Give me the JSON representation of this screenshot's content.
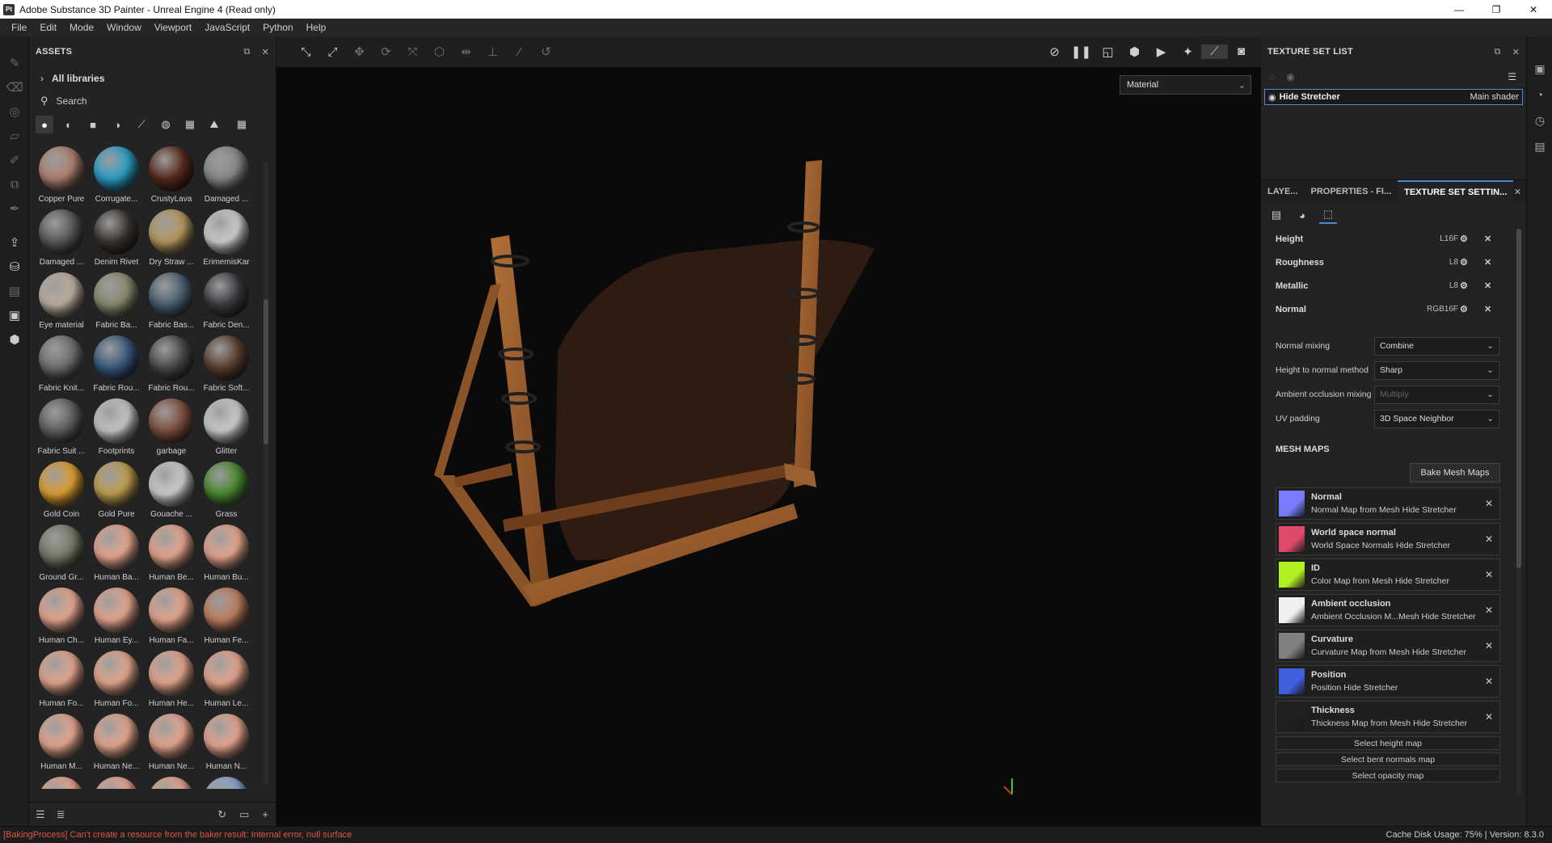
{
  "window": {
    "title": "Adobe Substance 3D Painter - Unreal Engine 4 (Read only)",
    "logo": "Pt"
  },
  "menu": [
    "File",
    "Edit",
    "Mode",
    "Window",
    "Viewport",
    "JavaScript",
    "Python",
    "Help"
  ],
  "assets": {
    "title": "ASSETS",
    "libraries": "All libraries",
    "search_placeholder": "Search",
    "items": [
      {
        "label": "Copper Pure",
        "color": "#b08070"
      },
      {
        "label": "Corrugate...",
        "color": "#2aa0c8"
      },
      {
        "label": "CrustyLava",
        "color": "#5a2a1c"
      },
      {
        "label": "Damaged ...",
        "color": "#8a8a8a"
      },
      {
        "label": "Damaged ...",
        "color": "#5a5a5a"
      },
      {
        "label": "Denim Rivet",
        "color": "#3a3430"
      },
      {
        "label": "Dry Straw ...",
        "color": "#b89a60"
      },
      {
        "label": "ErimemisKar",
        "color": "#d0d0d0"
      },
      {
        "label": "Eye material",
        "color": "#c0b0a0"
      },
      {
        "label": "Fabric Ba...",
        "color": "#8a8a70"
      },
      {
        "label": "Fabric Bas...",
        "color": "#4a6070"
      },
      {
        "label": "Fabric Den...",
        "color": "#3a3c40"
      },
      {
        "label": "Fabric Knit...",
        "color": "#707070"
      },
      {
        "label": "Fabric Rou...",
        "color": "#3a5a80"
      },
      {
        "label": "Fabric Rou...",
        "color": "#4a4a4a"
      },
      {
        "label": "Fabric Soft...",
        "color": "#5a4030"
      },
      {
        "label": "Fabric Suit ...",
        "color": "#606060"
      },
      {
        "label": "Footprints",
        "color": "#c8c8c8"
      },
      {
        "label": "garbage",
        "color": "#805040"
      },
      {
        "label": "Glitter",
        "color": "#d0d0d0"
      },
      {
        "label": "Gold Coin",
        "color": "#e0a030"
      },
      {
        "label": "Gold Pure",
        "color": "#c0a050"
      },
      {
        "label": "Gouache ...",
        "color": "#d0d0d0"
      },
      {
        "label": "Grass",
        "color": "#4a8a30"
      },
      {
        "label": "Ground Gr...",
        "color": "#7a7a6a"
      },
      {
        "label": "Human Ba...",
        "color": "#e8a890"
      },
      {
        "label": "Human Be...",
        "color": "#e8a890"
      },
      {
        "label": "Human Bu...",
        "color": "#e8a890"
      },
      {
        "label": "Human Ch...",
        "color": "#e8a890"
      },
      {
        "label": "Human Ey...",
        "color": "#e8a890"
      },
      {
        "label": "Human Fa...",
        "color": "#e8a890"
      },
      {
        "label": "Human Fe...",
        "color": "#c08060"
      },
      {
        "label": "Human Fo...",
        "color": "#e8a890"
      },
      {
        "label": "Human Fo...",
        "color": "#e8a890"
      },
      {
        "label": "Human He...",
        "color": "#e8a890"
      },
      {
        "label": "Human Le...",
        "color": "#e8a890"
      },
      {
        "label": "Human M...",
        "color": "#e8a890"
      },
      {
        "label": "Human Ne...",
        "color": "#e8a890"
      },
      {
        "label": "Human Ne...",
        "color": "#e8a890"
      },
      {
        "label": "Human N...",
        "color": "#e8a890"
      },
      {
        "label": "",
        "color": "#e8a890"
      },
      {
        "label": "",
        "color": "#e8a890"
      },
      {
        "label": "",
        "color": "#e8a890"
      },
      {
        "label": "",
        "color": "#8aa8d0"
      }
    ]
  },
  "viewport": {
    "mode": "Material"
  },
  "texture_set_list": {
    "title": "TEXTURE SET LIST",
    "set_name": "Hide Stretcher",
    "shader": "Main shader"
  },
  "texture_set_settings": {
    "tabs": [
      "LAYE...",
      "PROPERTIES - FI...",
      "TEXTURE SET SETTIN..."
    ],
    "channels": [
      {
        "name": "Height",
        "format": "L16F"
      },
      {
        "name": "Roughness",
        "format": "L8"
      },
      {
        "name": "Metallic",
        "format": "L8"
      },
      {
        "name": "Normal",
        "format": "RGB16F"
      }
    ],
    "props": [
      {
        "label": "Normal mixing",
        "value": "Combine",
        "disabled": false
      },
      {
        "label": "Height to normal method",
        "value": "Sharp",
        "disabled": false
      },
      {
        "label": "Ambient occlusion mixing",
        "value": "Multiply",
        "disabled": true
      },
      {
        "label": "UV padding",
        "value": "3D Space Neighbor",
        "disabled": false
      }
    ],
    "mesh_maps_title": "MESH MAPS",
    "bake_label": "Bake Mesh Maps",
    "mesh_maps": [
      {
        "name": "Normal",
        "desc": "Normal Map from Mesh Hide Stretcher",
        "color": "#7a7aff"
      },
      {
        "name": "World space normal",
        "desc": "World Space Normals Hide Stretcher",
        "color": "#e04a6a"
      },
      {
        "name": "ID",
        "desc": "Color Map from Mesh Hide Stretcher",
        "color": "#b0f020"
      },
      {
        "name": "Ambient occlusion",
        "desc": "Ambient Occlusion M...Mesh Hide Stretcher",
        "color": "#f0f0f0"
      },
      {
        "name": "Curvature",
        "desc": "Curvature Map from Mesh Hide Stretcher",
        "color": "#808080"
      },
      {
        "name": "Position",
        "desc": "Position Hide Stretcher",
        "color": "#4060e0"
      },
      {
        "name": "Thickness",
        "desc": "Thickness Map from Mesh Hide Stretcher",
        "color": "#202020"
      }
    ],
    "select_buttons": [
      "Select height map",
      "Select bent normals map",
      "Select opacity map"
    ]
  },
  "status": {
    "error": "[BakingProcess] Can't create a resource from the baker result: Internal error, null surface",
    "right": "Cache Disk Usage:   75% | Version: 8.3.0"
  }
}
